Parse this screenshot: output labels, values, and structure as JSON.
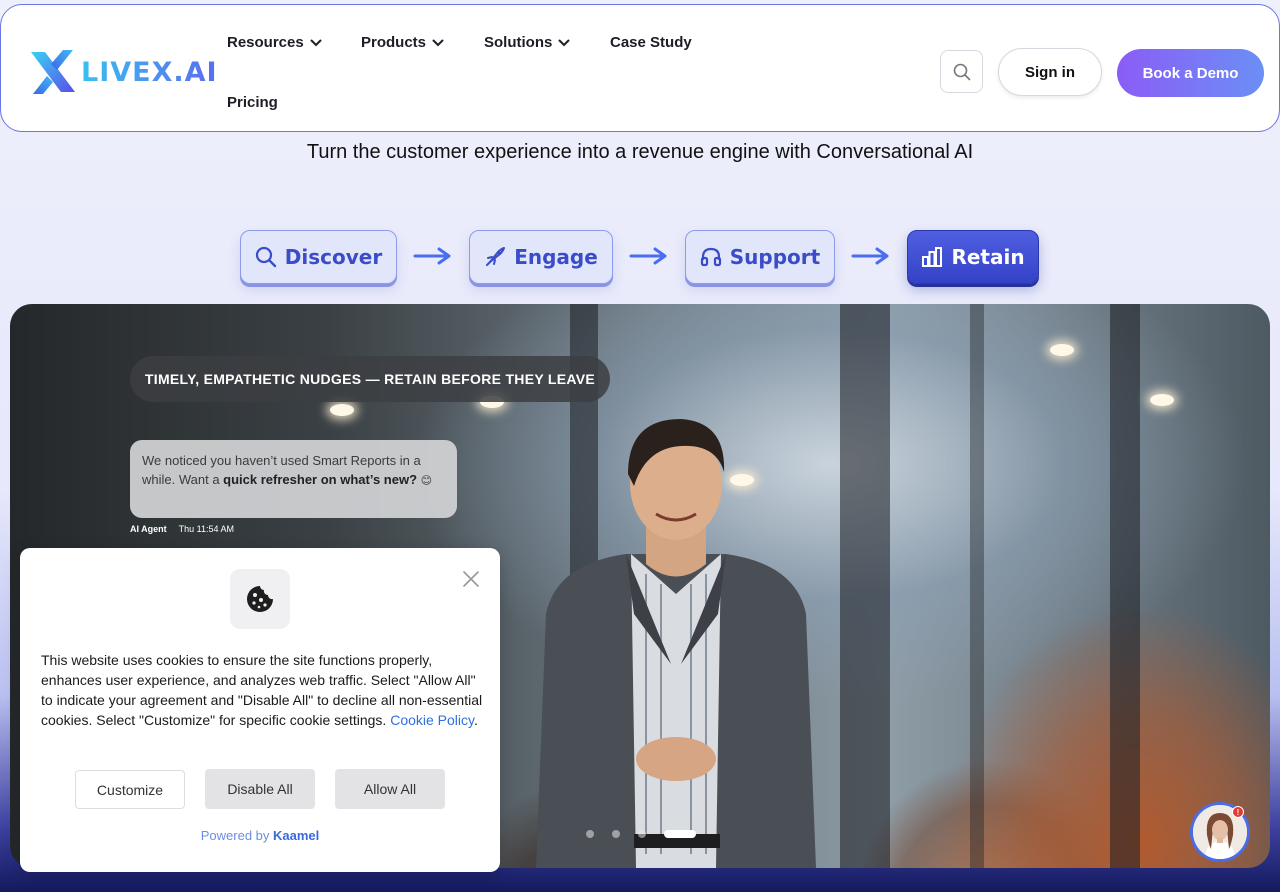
{
  "brand": {
    "name": "LIVEX.AI",
    "logo_icon": "livex-x-logo"
  },
  "nav": {
    "items": [
      {
        "label": "Resources",
        "has_dropdown": true
      },
      {
        "label": "Products",
        "has_dropdown": true
      },
      {
        "label": "Solutions",
        "has_dropdown": true
      },
      {
        "label": "Case Study",
        "has_dropdown": false
      },
      {
        "label": "Pricing",
        "has_dropdown": false
      }
    ],
    "search_icon": "search-icon",
    "signin_label": "Sign in",
    "demo_label": "Book a Demo"
  },
  "hero": {
    "headline": "Turn the customer experience into a revenue engine with Conversational AI",
    "steps": [
      {
        "label": "Discover",
        "icon": "search-icon",
        "active": false
      },
      {
        "label": "Engage",
        "icon": "rocket-icon",
        "active": false
      },
      {
        "label": "Support",
        "icon": "headset-icon",
        "active": false
      },
      {
        "label": "Retain",
        "icon": "bar-chart-icon",
        "active": true
      }
    ],
    "tagline": "TIMELY, EMPATHETIC NUDGES — RETAIN BEFORE THEY LEAVE",
    "chat": {
      "text_pre": "We noticed you haven’t used Smart Reports in a while.  Want a ",
      "text_bold": "quick refresher on what’s new?",
      "emoji": "😊",
      "sender": "AI Agent",
      "time": "Thu 11:54 AM"
    },
    "carousel": {
      "slides": 4,
      "active_index": 3
    }
  },
  "cookie_banner": {
    "icon": "cookie-icon",
    "text": "This website uses cookies to ensure the site functions properly, enhances user experience, and analyzes web traffic. Select \"Allow All\" to indicate your agreement and \"Disable All\" to decline all non-essential cookies. Select \"Customize\" for specific cookie settings. ",
    "policy_link": "Cookie Policy",
    "policy_suffix": ".",
    "buttons": {
      "customize": "Customize",
      "disable": "Disable All",
      "allow": "Allow All"
    },
    "powered_prefix": "Powered by ",
    "powered_brand": "Kaamel"
  },
  "chat_widget": {
    "badge": "!"
  },
  "colors": {
    "accent": "#3442c8",
    "demo_start": "#8b5cf6",
    "demo_end": "#6b8ff5",
    "link": "#2f6fe0"
  }
}
